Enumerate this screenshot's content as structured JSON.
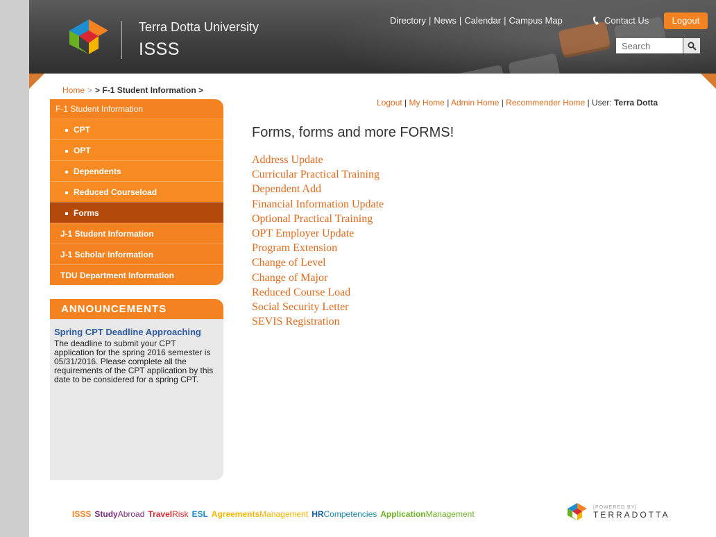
{
  "header": {
    "university": "Terra Dotta University",
    "department": "ISSS",
    "nav": [
      "Directory",
      "News",
      "Calendar",
      "Campus Map"
    ],
    "contact_label": "Contact Us",
    "logout_label": "Logout",
    "search_placeholder": "Search"
  },
  "breadcrumb": {
    "home": "Home",
    "current": "> F-1 Student Information >"
  },
  "sidebar": {
    "section": "F-1 Student Information",
    "sub_items": [
      "CPT",
      "OPT",
      "Dependents",
      "Reduced Courseload",
      "Forms"
    ],
    "other_items": [
      "J-1 Student Information",
      "J-1 Scholar Information",
      "TDU Department Information"
    ]
  },
  "announcements": {
    "heading": "ANNOUNCEMENTS",
    "title": "Spring CPT Deadline Approaching",
    "body": "The deadline to submit your CPT application for the spring 2016 semester is 05/31/2016. Please complete all the requirements of the CPT application by this date to be considered for a spring CPT."
  },
  "userbar": {
    "links": [
      "Logout",
      "My Home",
      "Admin Home",
      "Recommender Home"
    ],
    "user_label": "User:",
    "user_name": "Terra Dotta"
  },
  "main": {
    "title": "Forms, forms and more FORMS!",
    "forms": [
      "Address Update",
      "Curricular Practical Training",
      "Dependent Add",
      "Financial Information Update",
      "Optional Practical Training",
      "OPT Employer Update",
      "Program Extension",
      "Change of Level",
      "Change of Major",
      "Reduced Course Load",
      "Social Security Letter",
      "SEVIS Registration"
    ]
  },
  "footer": {
    "products": [
      {
        "a": "ISSS",
        "b": "",
        "ca": "#f58220",
        "cb": "#f58220"
      },
      {
        "a": "Study",
        "b": "Abroad",
        "ca": "#7a2a7a",
        "cb": "#7a2a7a"
      },
      {
        "a": "Travel",
        "b": "Risk",
        "ca": "#d9282f",
        "cb": "#d9282f"
      },
      {
        "a": "ESL",
        "b": "",
        "ca": "#1d8fd1",
        "cb": "#1d8fd1"
      },
      {
        "a": "Agreements",
        "b": "Management",
        "ca": "#f4b400",
        "cb": "#f4b400"
      },
      {
        "a": "HR",
        "b": "Competencies",
        "ca": "#1b5fa3",
        "cb": "#1b8aa8"
      },
      {
        "a": "Application",
        "b": "Management",
        "ca": "#6ab023",
        "cb": "#6ab023"
      }
    ],
    "powered_small": "[POWERED BY]",
    "powered_big": "TERRADOTTA"
  },
  "colors": {
    "accent": "#f58220",
    "link": "#e06a1d"
  }
}
